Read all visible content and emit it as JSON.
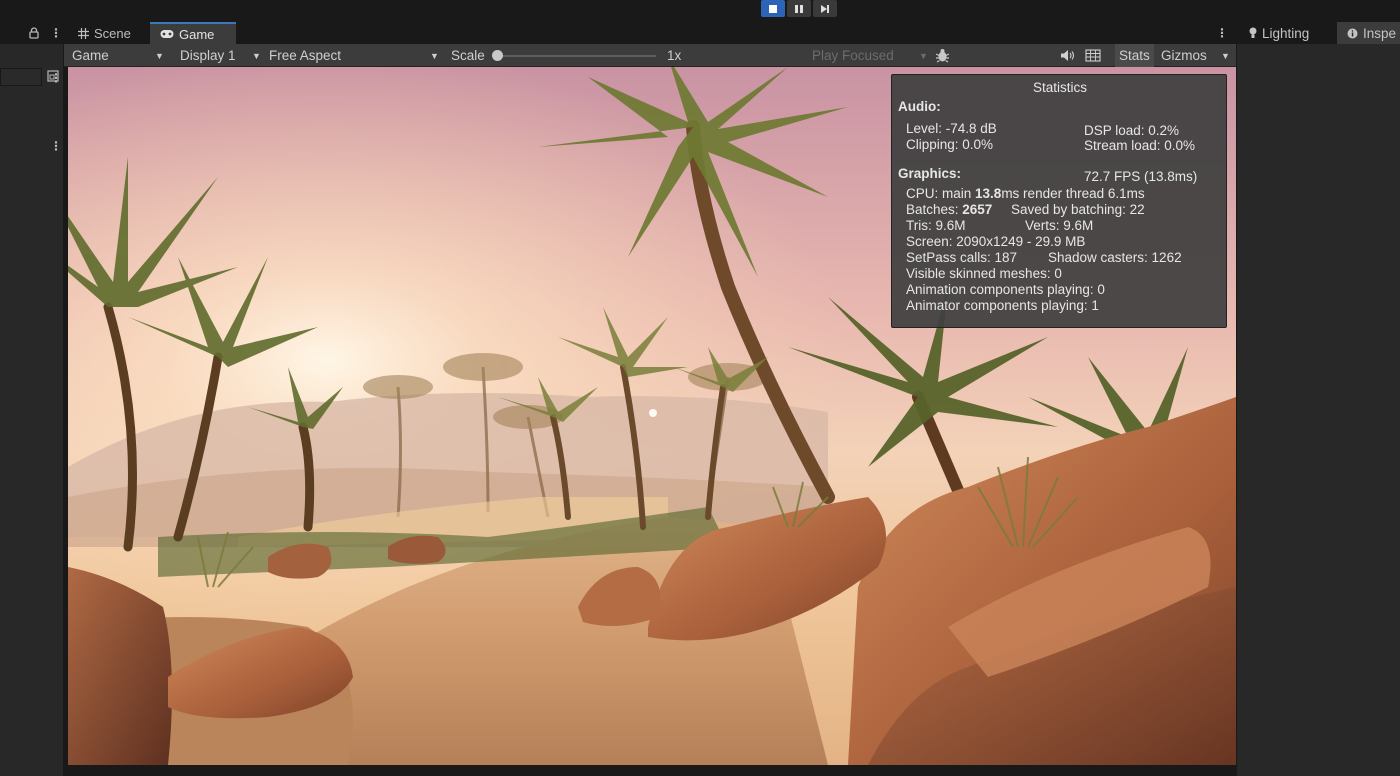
{
  "play_controls": [
    "play-stop",
    "pause",
    "step"
  ],
  "tabs": {
    "scene": "Scene",
    "game": "Game"
  },
  "toolbar": {
    "mode": "Game",
    "display": "Display 1",
    "aspect": "Free Aspect",
    "scale_label": "Scale",
    "scale_value": "1x",
    "play_focused": "Play Focused",
    "stats": "Stats",
    "gizmos": "Gizmos"
  },
  "right_tabs": {
    "lighting": "Lighting",
    "inspector": "Inspe"
  },
  "stats": {
    "title": "Statistics",
    "audio_header": "Audio:",
    "level": "Level: -74.8 dB",
    "clipping": "Clipping: 0.0%",
    "dsp_load": "DSP load: 0.2%",
    "stream_load": "Stream load: 0.0%",
    "graphics_header": "Graphics:",
    "fps": "72.7 FPS (13.8ms)",
    "cpu_prefix": "CPU: main ",
    "cpu_main": "13.8",
    "cpu_suffix": "ms  render thread 6.1ms",
    "batches_prefix": "Batches: ",
    "batches": "2657",
    "saved_batching": "Saved by batching: 22",
    "tris": "Tris: 9.6M",
    "verts": "Verts: 9.6M",
    "screen": "Screen: 2090x1249 - 29.9 MB",
    "setpass": "SetPass calls: 187",
    "shadow_casters": "Shadow casters: 1262",
    "skinned_meshes": "Visible skinned meshes: 0",
    "animation_components": "Animation components playing: 0",
    "animator_components": "Animator components playing: 1"
  },
  "colors": {
    "accent": "#2d64b8",
    "panel_bg": "#282828",
    "toolbar_bg": "#3c3c3c",
    "tab_bar_bg": "#191919",
    "stats_bg": "#404040"
  }
}
